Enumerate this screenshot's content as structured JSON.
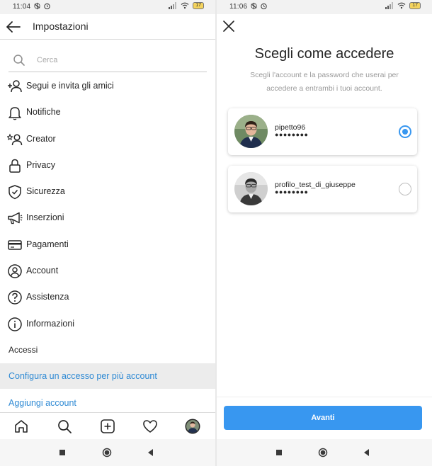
{
  "left": {
    "status": {
      "time": "11:04",
      "battery": "17"
    },
    "header": {
      "title": "Impostazioni"
    },
    "search": {
      "placeholder": "Cerca"
    },
    "menu": [
      {
        "label": "Segui e invita gli amici",
        "icon": "add-person-icon"
      },
      {
        "label": "Notifiche",
        "icon": "bell-icon"
      },
      {
        "label": "Creator",
        "icon": "creator-icon"
      },
      {
        "label": "Privacy",
        "icon": "lock-icon"
      },
      {
        "label": "Sicurezza",
        "icon": "shield-icon"
      },
      {
        "label": "Inserzioni",
        "icon": "megaphone-icon"
      },
      {
        "label": "Pagamenti",
        "icon": "card-icon"
      },
      {
        "label": "Account",
        "icon": "account-icon"
      },
      {
        "label": "Assistenza",
        "icon": "help-icon"
      },
      {
        "label": "Informazioni",
        "icon": "info-icon"
      }
    ],
    "section_title": "Accessi",
    "links": {
      "configure": "Configura un accesso per più account",
      "add_account": "Aggiungi account"
    },
    "tabbar": [
      "home-icon",
      "search-icon",
      "add-post-icon",
      "heart-icon",
      "profile-avatar"
    ]
  },
  "right": {
    "status": {
      "time": "11:06",
      "battery": "17"
    },
    "title": "Scegli come accedere",
    "subtitle": "Scegli l'account e la password che userai per accedere a entrambi i tuoi account.",
    "accounts": [
      {
        "username": "pipetto96",
        "password_mask": "●●●●●●●●",
        "selected": true
      },
      {
        "username": "profilo_test_di_giuseppe",
        "password_mask": "●●●●●●●●",
        "selected": false
      }
    ],
    "button": "Avanti"
  },
  "colors": {
    "accent": "#3897f0",
    "link": "#2f8ad4",
    "text": "#262626",
    "muted": "#9a9a9a"
  }
}
